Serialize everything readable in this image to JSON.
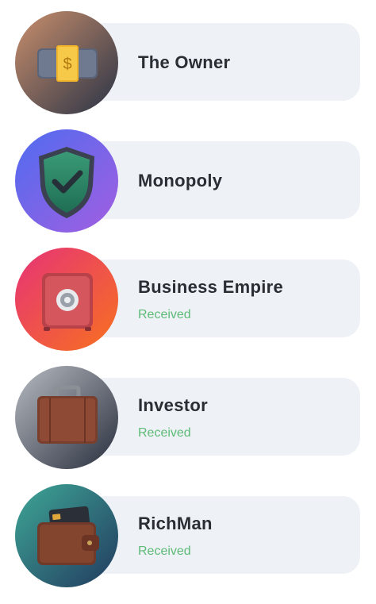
{
  "achievements": [
    {
      "title": "The Owner",
      "status": "",
      "icon": "money-stack-icon",
      "badge_gradient": [
        "#c98f6c",
        "#2a3346"
      ]
    },
    {
      "title": "Monopoly",
      "status": "",
      "icon": "shield-check-icon",
      "badge_gradient": [
        "#5a64e8",
        "#9c5fe0"
      ]
    },
    {
      "title": "Business Empire",
      "status": "Received",
      "icon": "safe-icon",
      "badge_gradient": [
        "#e93a6a",
        "#f56a2a"
      ]
    },
    {
      "title": "Investor",
      "status": "Received",
      "icon": "briefcase-icon",
      "badge_gradient": [
        "#a9adb4",
        "#2c3141"
      ]
    },
    {
      "title": "RichMan",
      "status": "Received",
      "icon": "wallet-icon",
      "badge_gradient": [
        "#3fa392",
        "#253a5e"
      ]
    }
  ],
  "colors": {
    "card_bg": "#eef1f6",
    "title": "#2a2d33",
    "received": "#5dbb77"
  }
}
